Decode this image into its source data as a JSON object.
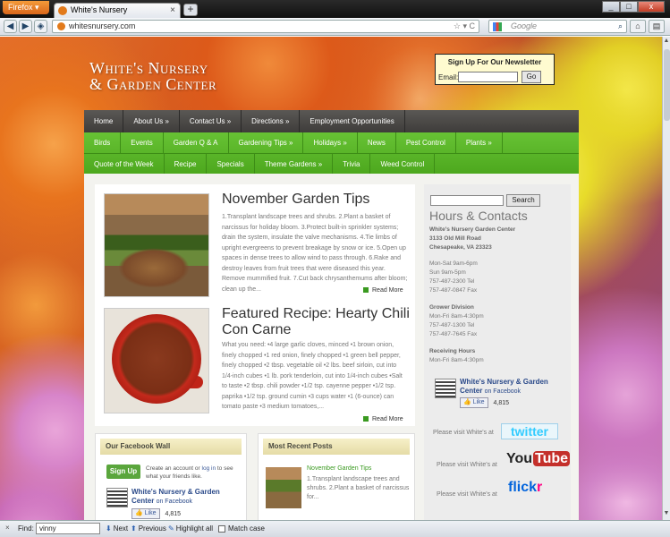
{
  "browser": {
    "firefox_label": "Firefox",
    "tab_title": "White's Nursery",
    "new_tab": "+",
    "url": "whitesnursery.com",
    "search_placeholder": "Google",
    "window_buttons": [
      "_",
      "□",
      "x"
    ]
  },
  "site": {
    "logo_line1": "White's Nursery",
    "logo_line2": "& Garden Center",
    "newsletter": {
      "title": "Sign Up For Our Newsletter",
      "email_label": "Email:",
      "go_label": "Go"
    },
    "main_nav": [
      "Home",
      "About Us »",
      "Contact Us »",
      "Directions »",
      "Employment Opportunities"
    ],
    "green_nav_row1": [
      "Birds",
      "Events",
      "Garden Q & A",
      "Gardening Tips »",
      "Holidays »",
      "News",
      "Pest Control",
      "Plants »"
    ],
    "green_nav_row2": [
      "Quote of the Week",
      "Recipe",
      "Specials",
      "Theme Gardens »",
      "Trivia",
      "Weed Control"
    ]
  },
  "posts": [
    {
      "title": "November Garden Tips",
      "excerpt": "1.Transplant landscape trees and shrubs. 2.Plant a basket of narcissus for holiday bloom. 3.Protect built-in sprinkler systems; drain the system, insulate the valve mechanisms. 4.Tie limbs of upright evergreens to prevent breakage by snow or ice. 5.Open up spaces in dense trees to allow wind to pass through. 6.Rake and destroy leaves from fruit trees that were diseased this year. Remove mummified fruit. 7.Cut back chrysanthemums after bloom; clean up the...",
      "more": "Read More"
    },
    {
      "title": "Featured Recipe: Hearty Chili Con Carne",
      "excerpt": "What you need: •4 large garlic cloves, minced •1 brown onion, finely chopped •1 red onion, finely chopped •1 green bell pepper, finely chopped •2 tbsp. vegetable oil •2 lbs. beef sirloin, cut into 1/4-inch cubes •1 lb. pork tenderloin, cut into 1/4-inch cubes •Salt to taste •2 tbsp. chili powder •1/2 tsp. cayenne pepper •1/2 tsp. paprika •1/2 tsp. ground cumin •3 cups water •1 (6-ounce) can tomato paste •3 medium tomatoes,...",
      "more": "Read More"
    }
  ],
  "sidebar": {
    "search_button": "Search",
    "heading": "Hours & Contacts",
    "address": [
      "White's Nursery Garden Center",
      "3133 Old Mill Road",
      "Chesapeake, VA 23323"
    ],
    "main_hours": [
      "Mon-Sat 9am-6pm",
      "Sun 9am-5pm",
      "757-487-2300 Tel",
      "757-487-0847 Fax"
    ],
    "grower_title": "Grower Division",
    "grower_hours": [
      "Mon-Fri 8am-4:30pm",
      "757-487-1300 Tel",
      "757-487-7645 Fax"
    ],
    "receiving_title": "Receiving Hours",
    "receiving_hours": [
      "Mon-Fri 8am-4:30pm"
    ],
    "fb_name": "White's Nursery & Garden Center",
    "fb_on": "on Facebook",
    "like_label": "Like",
    "like_count": "4,815",
    "visit_text": "Please visit White's at",
    "twitter": "twitter",
    "youtube_you": "You",
    "youtube_tube": "Tube",
    "flickr_fl": "flick",
    "flickr_r": "r"
  },
  "facebook_wall": {
    "title": "Our Facebook Wall",
    "signup": "Sign Up",
    "text_pre": "Create an account or",
    "login": "log in",
    "text_post": "to see what your friends like.",
    "page_name": "White's Nursery & Garden Center",
    "on_facebook": "on Facebook",
    "like_label": "Like",
    "like_count": "4,815"
  },
  "recent_posts": {
    "title": "Most Recent Posts",
    "post_title": "November Garden Tips",
    "post_excerpt": "1.Transplant landscape trees and shrubs. 2.Plant a basket of narcissus for..."
  },
  "findbar": {
    "label": "Find:",
    "value": "vinny",
    "next": "Next",
    "previous": "Previous",
    "highlight": "Highlight all",
    "match_case": "Match case"
  }
}
